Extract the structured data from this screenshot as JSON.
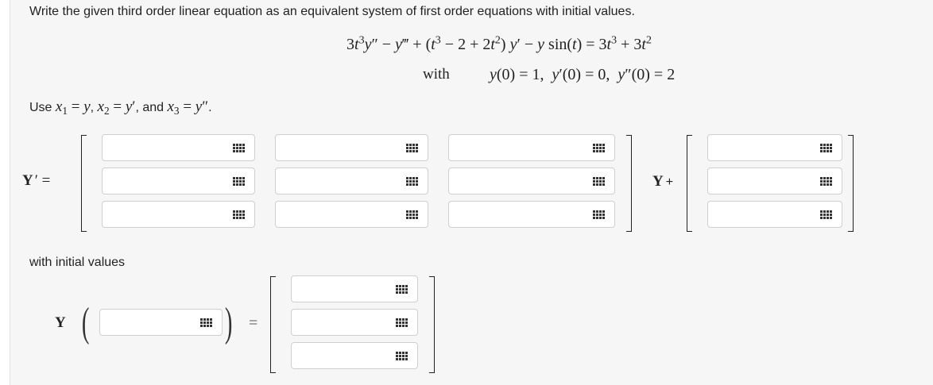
{
  "problem": {
    "prompt": "Write the given third order linear equation as an equivalent system of first order equations with initial values.",
    "with_word": "with",
    "substitution_prefix": "Use",
    "initial_values_label": "with initial values"
  },
  "system": {
    "y_prime_label": "Y",
    "y_prime_tail": "′ =",
    "y_plus_label": "Y",
    "plus_sign": "+",
    "matrix_cells": [
      "",
      "",
      "",
      "",
      "",
      "",
      "",
      "",
      ""
    ],
    "vector_cells": [
      "",
      "",
      ""
    ]
  },
  "initial": {
    "y_label": "Y",
    "equals_sign": "=",
    "argument_value": "",
    "vector_cells": [
      "",
      "",
      ""
    ]
  },
  "icons": {
    "keypad": "grid-keypad-icon"
  }
}
